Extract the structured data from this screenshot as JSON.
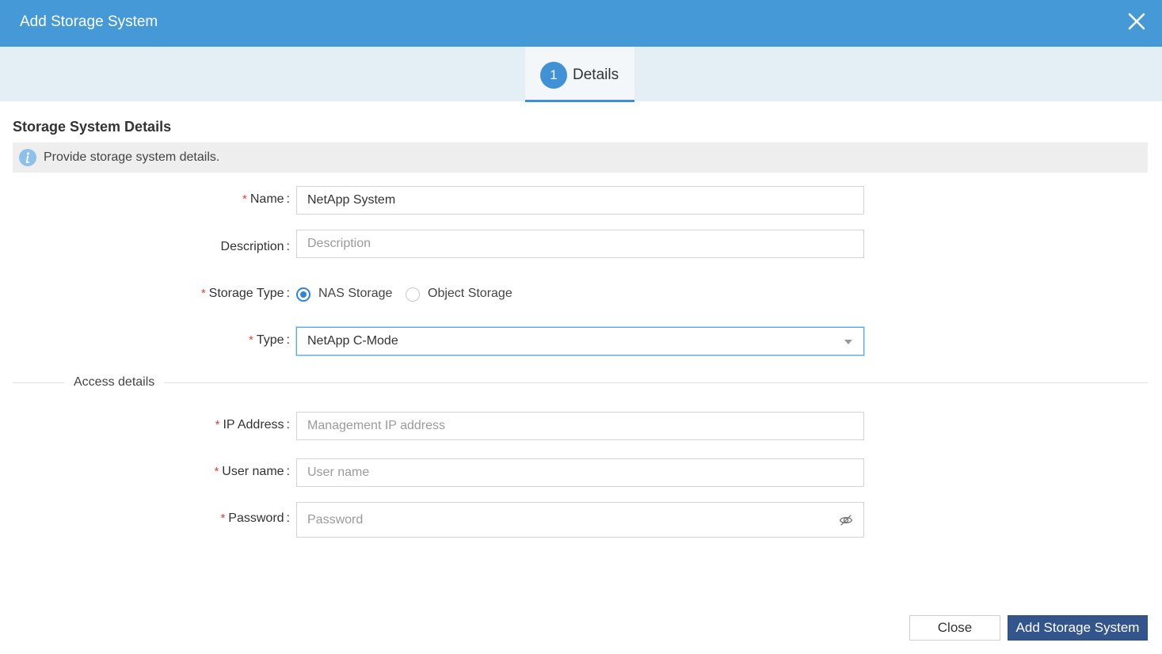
{
  "dialog": {
    "title": "Add Storage System",
    "close_icon": "close-icon"
  },
  "steps": [
    {
      "number": "1",
      "label": "Details",
      "active": true
    }
  ],
  "section": {
    "title": "Storage System Details",
    "info_icon": "info-icon",
    "info_text": "Provide storage system details."
  },
  "form": {
    "name": {
      "label": "Name",
      "required": true,
      "value": "NetApp System"
    },
    "description": {
      "label": "Description",
      "required": false,
      "value": "",
      "placeholder": "Description"
    },
    "storage_type": {
      "label": "Storage Type",
      "required": true,
      "options": [
        {
          "label": "NAS Storage",
          "checked": true
        },
        {
          "label": "Object Storage",
          "checked": false
        }
      ]
    },
    "type": {
      "label": "Type",
      "required": true,
      "value": "NetApp C-Mode"
    },
    "access_divider": "Access details",
    "ip_address": {
      "label": "IP Address",
      "required": true,
      "value": "",
      "placeholder": "Management IP address"
    },
    "user_name": {
      "label": "User name",
      "required": true,
      "value": "",
      "placeholder": "User name"
    },
    "password": {
      "label": "Password",
      "required": true,
      "value": "",
      "placeholder": "Password",
      "toggle_icon": "eye-off-icon"
    }
  },
  "footer": {
    "close_label": "Close",
    "add_label": "Add Storage System"
  },
  "colors": {
    "header": "#4599d6",
    "step_bar": "#e4eef5",
    "primary_button": "#34558c",
    "required": "#e0403a",
    "radio_accent": "#2f86d8"
  }
}
